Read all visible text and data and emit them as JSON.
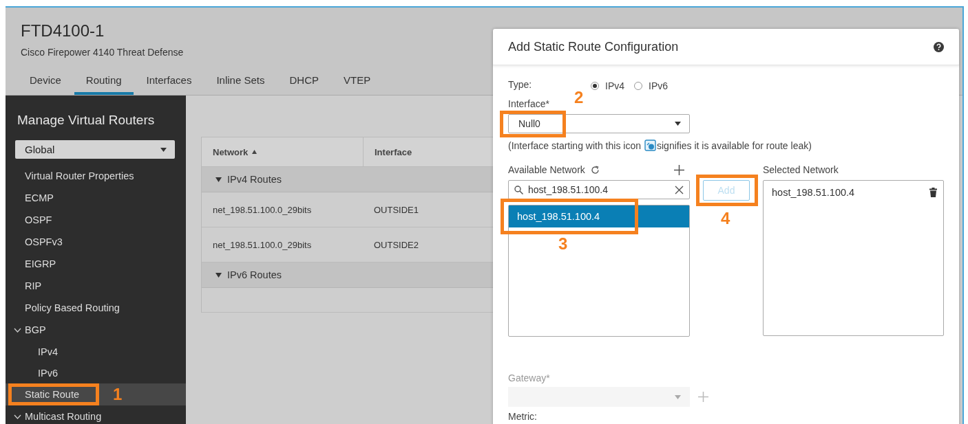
{
  "device": {
    "name": "FTD4100-1",
    "model": "Cisco Firepower 4140 Threat Defense"
  },
  "tabs": [
    {
      "label": "Device",
      "selected": false
    },
    {
      "label": "Routing",
      "selected": true
    },
    {
      "label": "Interfaces",
      "selected": false
    },
    {
      "label": "Inline Sets",
      "selected": false
    },
    {
      "label": "DHCP",
      "selected": false
    },
    {
      "label": "VTEP",
      "selected": false
    }
  ],
  "sidebar": {
    "title": "Manage Virtual Routers",
    "router_select": {
      "value": "Global"
    },
    "items": [
      {
        "label": "Virtual Router Properties",
        "selected": false
      },
      {
        "label": "ECMP",
        "selected": false
      },
      {
        "label": "OSPF",
        "selected": false
      },
      {
        "label": "OSPFv3",
        "selected": false
      },
      {
        "label": "EIGRP",
        "selected": false
      },
      {
        "label": "RIP",
        "selected": false
      },
      {
        "label": "Policy Based Routing",
        "selected": false
      },
      {
        "label": "BGP",
        "selected": false,
        "expanded": true,
        "children": [
          {
            "label": "IPv4",
            "selected": false
          },
          {
            "label": "IPv6",
            "selected": false
          }
        ]
      },
      {
        "label": "Static Route",
        "selected": true,
        "callout": {
          "label": "1",
          "kind": "right"
        }
      },
      {
        "label": "Multicast Routing",
        "selected": false,
        "expanded": true
      }
    ]
  },
  "table": {
    "columns": [
      {
        "label": "Network",
        "sorted": true
      },
      {
        "label": "Interface",
        "sorted": false
      }
    ],
    "groups": [
      {
        "label": "IPv4 Routes",
        "expanded": true,
        "rows": [
          [
            "net_198.51.100.0_29bits",
            "OUTSIDE1"
          ],
          [
            "net_198.51.100.0_29bits",
            "OUTSIDE2"
          ]
        ]
      },
      {
        "label": "IPv6 Routes",
        "expanded": true
      }
    ]
  },
  "dialog": {
    "title": "Add Static Route Configuration",
    "type": {
      "label": "Type:",
      "options": [
        {
          "label": "IPv4",
          "selected": true
        },
        {
          "label": "IPv6",
          "selected": false
        }
      ]
    },
    "interface": {
      "label": "Interface*",
      "value": "Null0",
      "callout": {
        "label": "2",
        "kind": "above"
      }
    },
    "note": {
      "before": "(Interface starting with this icon",
      "after": "signifies it is available for route leak)"
    },
    "available": {
      "label": "Available Network",
      "search": "host_198.51.100.4",
      "items": [
        {
          "label": "host_198.51.100.4",
          "selected": true,
          "callout": {
            "label": "3",
            "kind": "below"
          }
        }
      ]
    },
    "add_button": {
      "label": "Add",
      "disabled": true,
      "callout": {
        "label": "4",
        "kind": "below"
      }
    },
    "selected_network": {
      "label": "Selected Network",
      "items": [
        "host_198.51.100.4"
      ]
    },
    "gateway": {
      "label": "Gateway*",
      "disabled": true
    },
    "metric": {
      "label": "Metric:"
    }
  }
}
